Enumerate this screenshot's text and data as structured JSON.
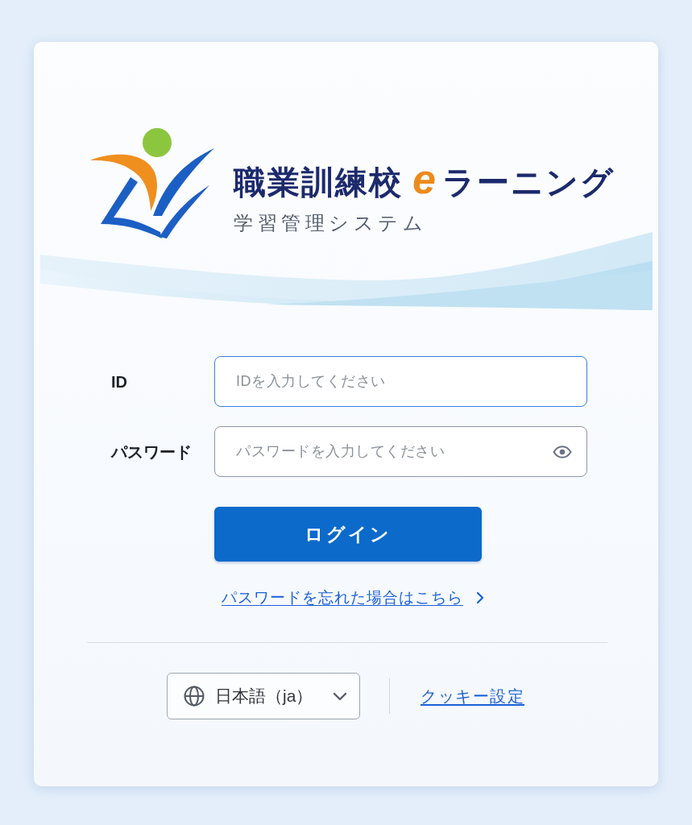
{
  "brand": {
    "title": [
      {
        "kind": "plain",
        "text": "職業訓練校"
      },
      {
        "kind": "accent",
        "text": "e"
      },
      {
        "kind": "plain",
        "text": "ラーニング"
      }
    ],
    "subtitle": "学習管理システム"
  },
  "form": {
    "fields": [
      {
        "kind": "text",
        "label": "ID",
        "placeholder": "IDを入力してください",
        "focused": true
      },
      {
        "kind": "password",
        "label": "パスワード",
        "placeholder": "パスワードを入力してください",
        "focused": false
      }
    ],
    "submit": "ログイン",
    "forgot_link": "パスワードを忘れた場合はこちら"
  },
  "footer": {
    "language": "日本語（ja）",
    "cookie_link": "クッキー設定"
  }
}
